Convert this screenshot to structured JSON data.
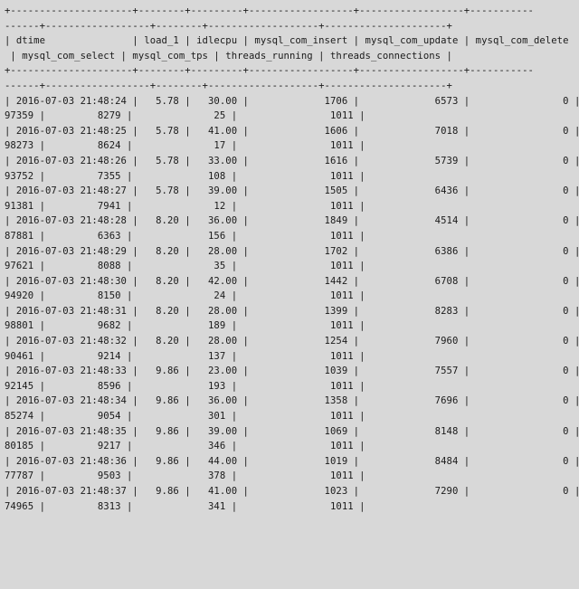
{
  "lines": [
    "+---------------------+--------+---------+------------------+------------------+-----------",
    "------+------------------+--------+-------------------+---------------------+",
    "| dtime               | load_1 | idlecpu | mysql_com_insert | mysql_com_update | mysql_com_delete",
    " | mysql_com_select | mysql_com_tps | threads_running | threads_connections |",
    "+---------------------+--------+---------+------------------+------------------+-----------",
    "------+------------------+--------+-------------------+---------------------+",
    "| 2016-07-03 21:48:24 |   5.78 |   30.00 |             1706 |             6573 |                0 |",
    "97359 |         8279 |              25 |                1011 |",
    "| 2016-07-03 21:48:25 |   5.78 |   41.00 |             1606 |             7018 |                0 |",
    "98273 |         8624 |              17 |                1011 |",
    "| 2016-07-03 21:48:26 |   5.78 |   33.00 |             1616 |             5739 |                0 |",
    "93752 |         7355 |             108 |                1011 |",
    "| 2016-07-03 21:48:27 |   5.78 |   39.00 |             1505 |             6436 |                0 |",
    "91381 |         7941 |              12 |                1011 |",
    "| 2016-07-03 21:48:28 |   8.20 |   36.00 |             1849 |             4514 |                0 |",
    "87881 |         6363 |             156 |                1011 |",
    "| 2016-07-03 21:48:29 |   8.20 |   28.00 |             1702 |             6386 |                0 |",
    "97621 |         8088 |              35 |                1011 |",
    "| 2016-07-03 21:48:30 |   8.20 |   42.00 |             1442 |             6708 |                0 |",
    "94920 |         8150 |              24 |                1011 |",
    "| 2016-07-03 21:48:31 |   8.20 |   28.00 |             1399 |             8283 |                0 |",
    "98801 |         9682 |             189 |                1011 |",
    "| 2016-07-03 21:48:32 |   8.20 |   28.00 |             1254 |             7960 |                0 |",
    "90461 |         9214 |             137 |                1011 |",
    "| 2016-07-03 21:48:33 |   9.86 |   23.00 |             1039 |             7557 |                0 |",
    "92145 |         8596 |             193 |                1011 |",
    "| 2016-07-03 21:48:34 |   9.86 |   36.00 |             1358 |             7696 |                0 |",
    "85274 |         9054 |             301 |                1011 |",
    "| 2016-07-03 21:48:35 |   9.86 |   39.00 |             1069 |             8148 |                0 |",
    "80185 |         9217 |             346 |                1011 |",
    "| 2016-07-03 21:48:36 |   9.86 |   44.00 |             1019 |             8484 |                0 |",
    "77787 |         9503 |             378 |                1011 |",
    "| 2016-07-03 21:48:37 |   9.86 |   41.00 |             1023 |             7290 |                0 |",
    "74965 |         8313 |             341 |                1011 |"
  ]
}
